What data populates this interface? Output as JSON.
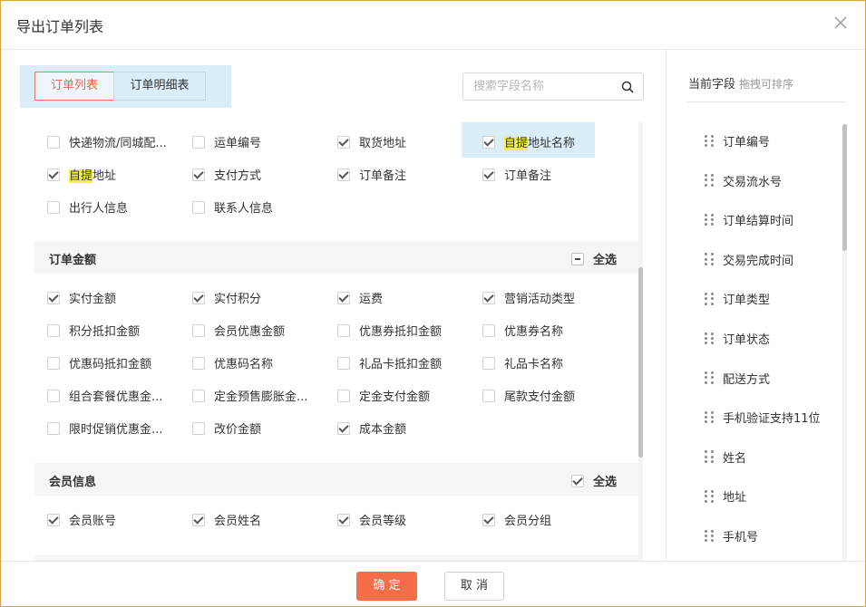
{
  "dialog": {
    "title": "导出订单列表"
  },
  "tabs": [
    {
      "label": "订单列表"
    },
    {
      "label": "订单明细表"
    }
  ],
  "search": {
    "placeholder": "搜索字段名称"
  },
  "basic_fields": [
    {
      "label": "快递物流/同城配...",
      "checked": false
    },
    {
      "label": "运单编号",
      "checked": false
    },
    {
      "label": "取货地址",
      "checked": true
    },
    {
      "pre": "",
      "highlight": "自提",
      "post": "地址名称",
      "checked": true
    },
    {
      "pre": "",
      "highlight": "自提",
      "post": "地址",
      "checked": true
    },
    {
      "label": "支付方式",
      "checked": true
    },
    {
      "label": "订单备注",
      "checked": true
    },
    {
      "label": "订单备注",
      "checked": true
    },
    {
      "label": "出行人信息",
      "checked": false
    },
    {
      "label": "联系人信息",
      "checked": false
    }
  ],
  "sections": [
    {
      "title": "订单金额",
      "select_all": "全选",
      "select_all_state": "partial",
      "fields": [
        {
          "label": "实付金额",
          "checked": true
        },
        {
          "label": "实付积分",
          "checked": true
        },
        {
          "label": "运费",
          "checked": true
        },
        {
          "label": "营销活动类型",
          "checked": true
        },
        {
          "label": "积分抵扣金额",
          "checked": false
        },
        {
          "label": "会员优惠金额",
          "checked": false
        },
        {
          "label": "优惠券抵扣金额",
          "checked": false
        },
        {
          "label": "优惠券名称",
          "checked": false
        },
        {
          "label": "优惠码抵扣金额",
          "checked": false
        },
        {
          "label": "优惠码名称",
          "checked": false
        },
        {
          "label": "礼品卡抵扣金额",
          "checked": false
        },
        {
          "label": "礼品卡名称",
          "checked": false
        },
        {
          "label": "组合套餐优惠金...",
          "checked": false
        },
        {
          "label": "定金预售膨胀金...",
          "checked": false
        },
        {
          "label": "定金支付金额",
          "checked": false
        },
        {
          "label": "尾款支付金额",
          "checked": false
        },
        {
          "label": "限时促销优惠金...",
          "checked": false
        },
        {
          "label": "改价金额",
          "checked": false
        },
        {
          "label": "成本金额",
          "checked": true
        }
      ]
    },
    {
      "title": "会员信息",
      "select_all": "全选",
      "select_all_state": "checked",
      "fields": [
        {
          "label": "会员账号",
          "checked": true
        },
        {
          "label": "会员姓名",
          "checked": true
        },
        {
          "label": "会员等级",
          "checked": true
        },
        {
          "label": "会员分组",
          "checked": true
        }
      ]
    }
  ],
  "current_fields": {
    "title": "当前字段",
    "hint": "拖拽可排序",
    "items": [
      "订单编号",
      "交易流水号",
      "订单结算时间",
      "交易完成时间",
      "订单类型",
      "订单状态",
      "配送方式",
      "手机验证支持11位",
      "姓名",
      "地址",
      "手机号"
    ]
  },
  "footer": {
    "ok_label": "确 定",
    "cancel_label": "取 消"
  },
  "colors": {
    "accent": "#f46e4a",
    "tab_bg": "#d9eef9",
    "highlight": "#f4f240",
    "border": "#d9a441"
  }
}
